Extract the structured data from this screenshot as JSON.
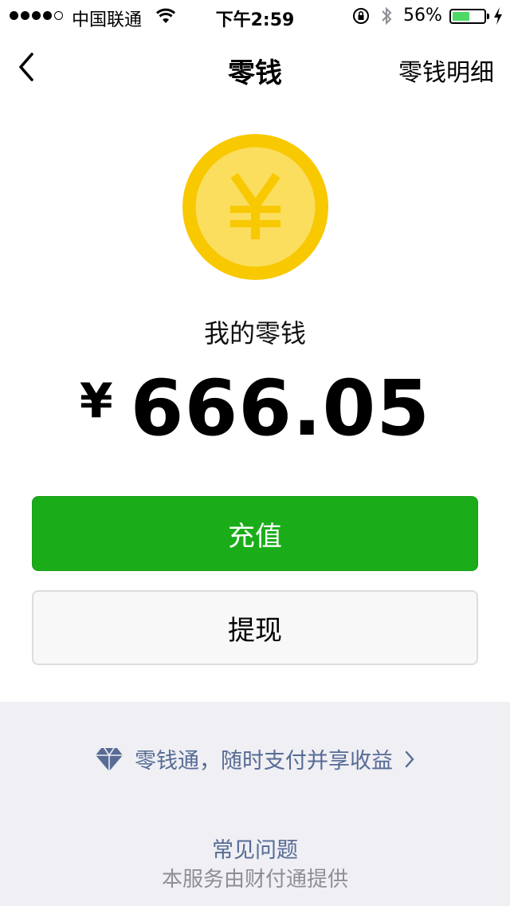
{
  "status_bar": {
    "carrier": "中国联通",
    "time": "下午2:59",
    "battery_percent": "56%",
    "battery_level": 0.56,
    "icons": [
      "signal-dots",
      "wifi-icon",
      "rotation-lock-icon",
      "bluetooth-icon",
      "battery-icon",
      "charging-icon"
    ]
  },
  "nav": {
    "back_icon": "back-chevron-icon",
    "title": "零钱",
    "right_action": "零钱明细"
  },
  "wallet": {
    "coin_icon": "yuan-coin-icon",
    "label": "我的零钱",
    "currency_symbol": "¥",
    "amount": "666.05"
  },
  "actions": {
    "recharge": "充值",
    "withdraw": "提现"
  },
  "footer": {
    "promo_text": "零钱通，随时支付并享收益",
    "promo_icon": "diamond-icon",
    "faq": "常见问题",
    "provider": "本服务由财付通提供"
  },
  "colors": {
    "primary_green": "#1aad19",
    "coin_outer": "#f8c800",
    "coin_inner": "#fbde5e",
    "link_blue": "#576b95",
    "footer_bg": "#efeff4"
  }
}
